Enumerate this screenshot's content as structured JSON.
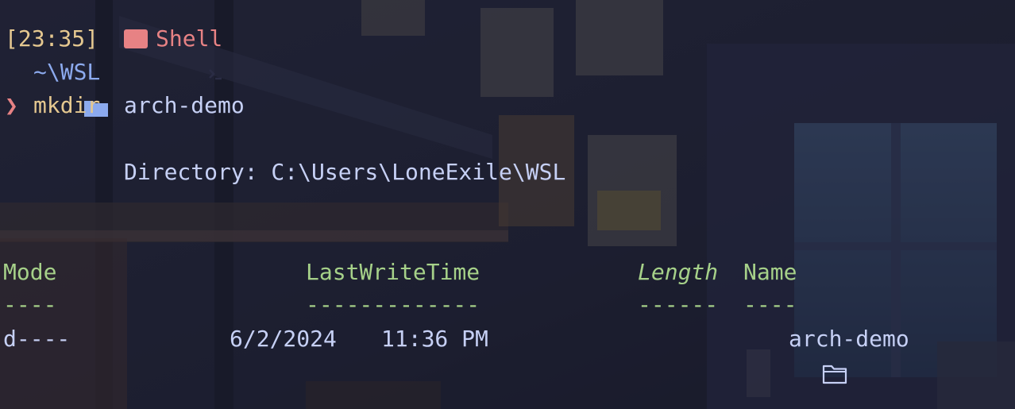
{
  "prompt": {
    "time": "[23:35]",
    "shell_icon": "terminal-prompt-icon",
    "shell_label": "Shell",
    "path_icon": "folder-icon",
    "path": "~\\WSL",
    "prompt_symbol": "❯",
    "command": "mkdir",
    "argument": "arch-demo"
  },
  "output": {
    "directory_line": "Directory: C:\\Users\\LoneExile\\WSL",
    "headers": {
      "mode": "Mode",
      "last_write_time": "LastWriteTime",
      "length": "Length",
      "name": "Name"
    },
    "underlines": {
      "mode": "----",
      "last_write_time": "-------------",
      "length": "------",
      "name": "----"
    },
    "row": {
      "mode": "d----",
      "date": "6/2/2024",
      "time": "11:36 PM",
      "name_icon": "folder-outline-icon",
      "name": "arch-demo"
    }
  },
  "colors": {
    "yellow": "#e5c890",
    "red": "#e78284",
    "blue": "#8caaee",
    "text": "#c6d0f5",
    "green": "#a6d189"
  }
}
